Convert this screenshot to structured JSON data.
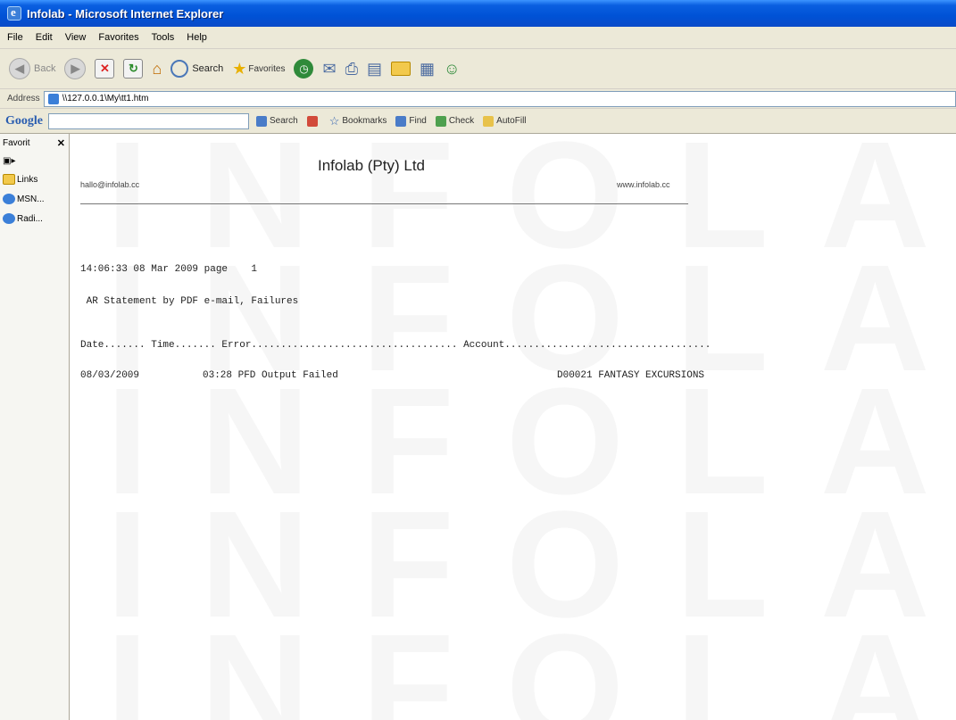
{
  "window": {
    "title": "Infolab - Microsoft Internet Explorer"
  },
  "menu": [
    "File",
    "Edit",
    "View",
    "Favorites",
    "Tools",
    "Help"
  ],
  "toolbar": {
    "back_label": "Back",
    "search_label": "Search",
    "favorites_label": "Favorites"
  },
  "address": {
    "label": "Address",
    "url": "\\\\127.0.0.1\\My\\tt1.htm"
  },
  "google_toolbar": {
    "logo": "Google",
    "search_label": "Search",
    "bookmarks_label": "Bookmarks",
    "find_label": "Find",
    "check_label": "Check",
    "autofill_label": "AutoFill"
  },
  "favorites_panel": {
    "header": "Favorit",
    "items": [
      "Links",
      "MSN...",
      "Radi..."
    ]
  },
  "report": {
    "company": "Infolab (Pty) Ltd",
    "email": "hallo@infolab.cc",
    "website": "www.infolab.cc",
    "timestamp_line": "14:06:33 08 Mar 2009 page    1",
    "report_title": " AR Statement by PDF e-mail, Failures",
    "columns_line": "Date....... Time....... Error................................... Account...................................",
    "rows": [
      {
        "date": "08/03/2009",
        "time_error": "03:28 PFD Output Failed",
        "account": "D00021 FANTASY EXCURSIONS"
      }
    ],
    "watermark": "INFOLAB"
  }
}
